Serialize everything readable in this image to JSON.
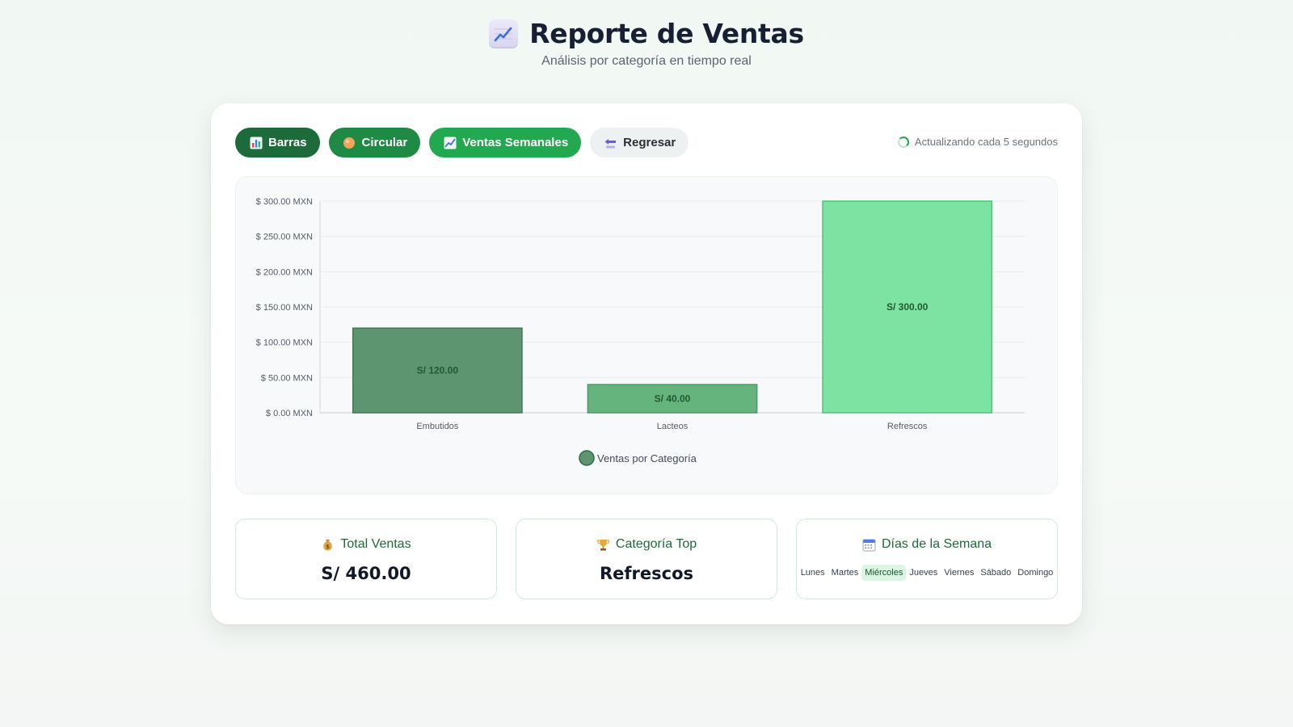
{
  "header": {
    "title": "Reporte de Ventas",
    "subtitle": "Análisis por categoría en tiempo real",
    "icon": "chart-increasing-icon"
  },
  "toolbar": {
    "buttons": [
      {
        "label": "Barras",
        "icon": "bar-chart-icon",
        "color": "#1d6b3a"
      },
      {
        "label": "Circular",
        "icon": "pie-icon",
        "color": "#1f8a44"
      },
      {
        "label": "Ventas Semanales",
        "icon": "line-chart-icon",
        "color": "#22a84f"
      },
      {
        "label": "Regresar",
        "icon": "back-arrow-icon",
        "color": "#eef1f2"
      }
    ],
    "status": "Actualizando cada 5 segundos"
  },
  "chart_data": {
    "type": "bar",
    "categories": [
      "Embutidos",
      "Lacteos",
      "Refrescos"
    ],
    "series": [
      {
        "name": "Ventas por Categoría",
        "values": [
          120,
          40,
          300
        ]
      }
    ],
    "data_labels": [
      "S/ 120.00",
      "S/ 40.00",
      "S/ 300.00"
    ],
    "bar_colors": [
      "#5c9570",
      "#65b47e",
      "#7de3a2"
    ],
    "ylim": [
      0,
      300
    ],
    "yticks": [
      "$ 0.00 MXN",
      "$ 50.00 MXN",
      "$ 100.00 MXN",
      "$ 150.00 MXN",
      "$ 200.00 MXN",
      "$ 250.00 MXN",
      "$ 300.00 MXN"
    ],
    "legend": "bottom",
    "grid": true
  },
  "stats": {
    "total": {
      "label": "Total Ventas",
      "value": "S/ 460.00",
      "icon": "money-bag-icon"
    },
    "top": {
      "label": "Categoría Top",
      "value": "Refrescos",
      "icon": "trophy-icon"
    },
    "days": {
      "label": "Días de la Semana",
      "icon": "calendar-icon",
      "items": [
        "Lunes",
        "Martes",
        "Miércoles",
        "Jueves",
        "Viernes",
        "Sábado",
        "Domingo"
      ],
      "active": "Miércoles"
    }
  }
}
